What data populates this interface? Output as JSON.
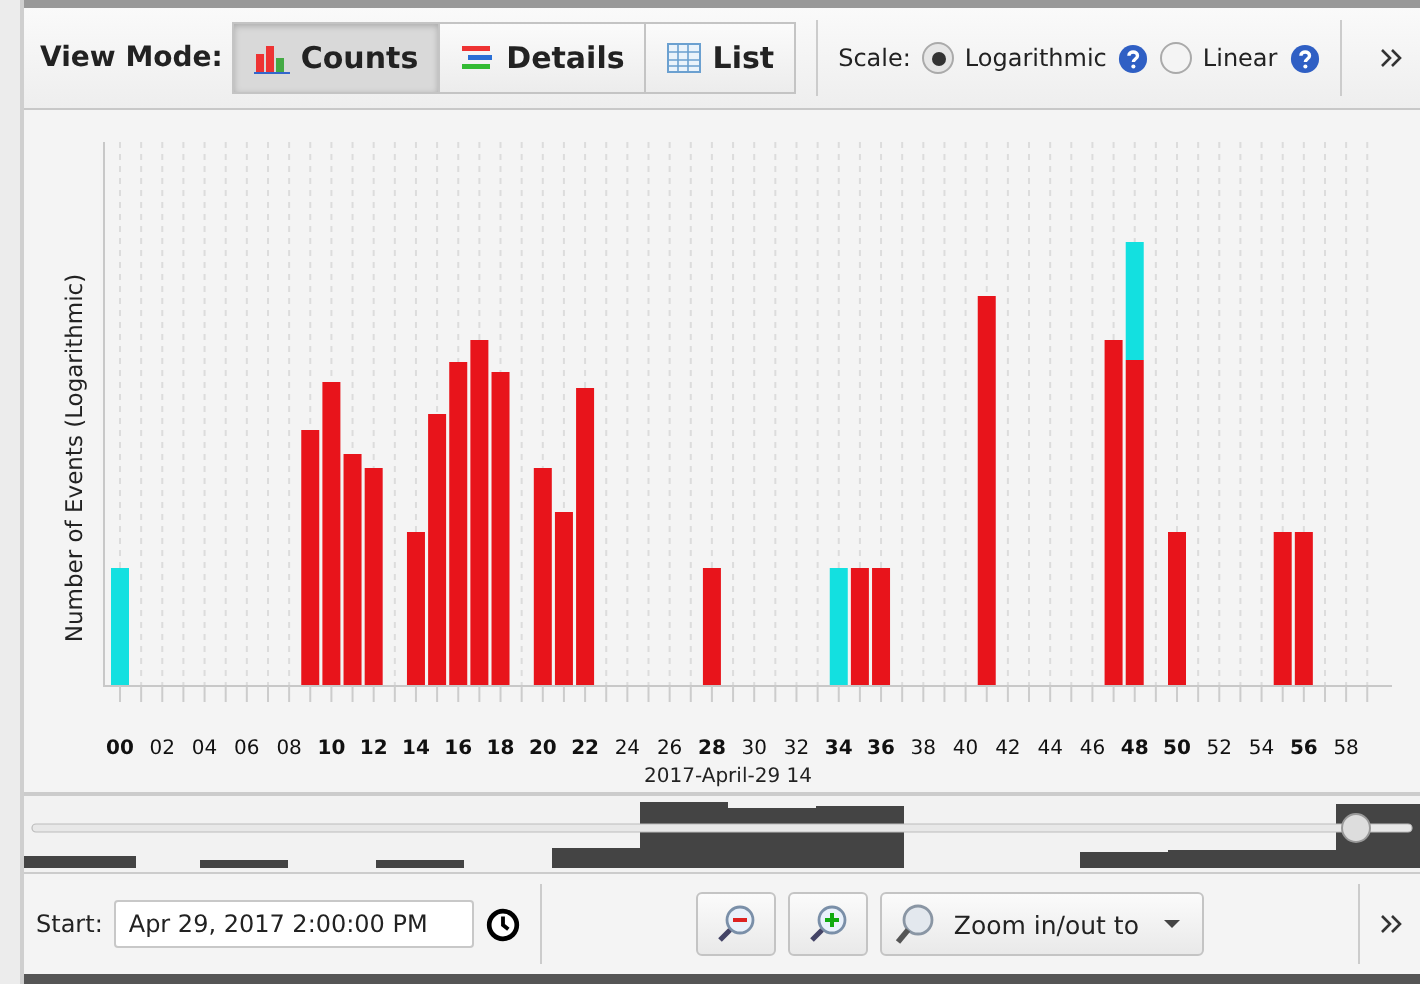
{
  "toolbar": {
    "view_mode_label": "View Mode:",
    "modes": [
      {
        "kind": "counts",
        "label": "Counts",
        "selected": true
      },
      {
        "kind": "details",
        "label": "Details",
        "selected": false
      },
      {
        "kind": "list",
        "label": "List",
        "selected": false
      }
    ],
    "scale_label": "Scale:",
    "scales": [
      {
        "label": "Logarithmic",
        "selected": true
      },
      {
        "label": "Linear",
        "selected": false
      }
    ]
  },
  "chart": {
    "ylabel": "Number of Events (Logarithmic)",
    "xlabel": "2017-April-29 14",
    "xticks": [
      {
        "label": "00",
        "bold": true
      },
      {
        "label": "02",
        "bold": false
      },
      {
        "label": "04",
        "bold": false
      },
      {
        "label": "06",
        "bold": false
      },
      {
        "label": "08",
        "bold": false
      },
      {
        "label": "10",
        "bold": true
      },
      {
        "label": "12",
        "bold": true
      },
      {
        "label": "14",
        "bold": true
      },
      {
        "label": "16",
        "bold": true
      },
      {
        "label": "18",
        "bold": true
      },
      {
        "label": "20",
        "bold": true
      },
      {
        "label": "22",
        "bold": true
      },
      {
        "label": "24",
        "bold": false
      },
      {
        "label": "26",
        "bold": false
      },
      {
        "label": "28",
        "bold": true
      },
      {
        "label": "30",
        "bold": false
      },
      {
        "label": "32",
        "bold": false
      },
      {
        "label": "34",
        "bold": true
      },
      {
        "label": "36",
        "bold": true
      },
      {
        "label": "38",
        "bold": false
      },
      {
        "label": "40",
        "bold": false
      },
      {
        "label": "42",
        "bold": false
      },
      {
        "label": "44",
        "bold": false
      },
      {
        "label": "46",
        "bold": false
      },
      {
        "label": "48",
        "bold": true
      },
      {
        "label": "50",
        "bold": true
      },
      {
        "label": "52",
        "bold": false
      },
      {
        "label": "54",
        "bold": false
      },
      {
        "label": "56",
        "bold": true
      },
      {
        "label": "58",
        "bold": false
      }
    ]
  },
  "footer": {
    "start_label": "Start:",
    "start_value": "Apr 29, 2017 2:00:00 PM",
    "zoom_menu": "Zoom in/out to"
  }
}
